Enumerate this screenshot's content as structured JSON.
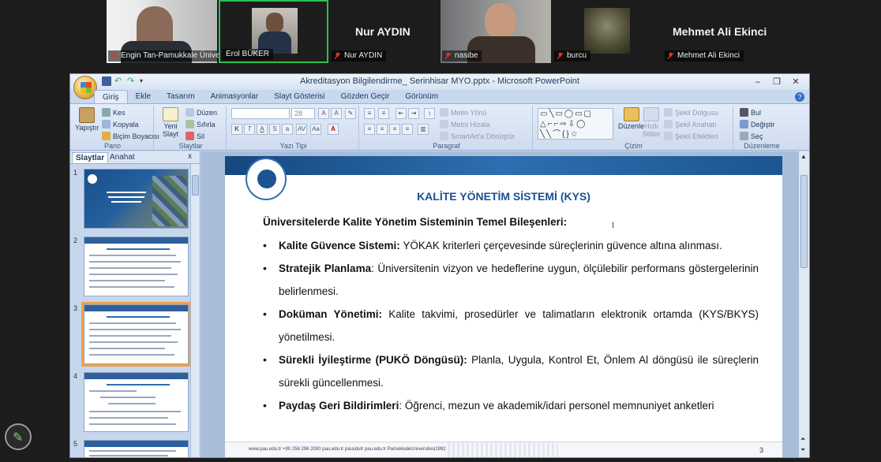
{
  "participants": [
    {
      "name": "Engin Tan-Pamukkale Üniver..."
    },
    {
      "name": "Erol BÜKER"
    },
    {
      "name": "Nur AYDIN",
      "big_name": "Nur AYDIN"
    },
    {
      "name": "nasibe"
    },
    {
      "name": "burcu"
    },
    {
      "name": "Mehmet Ali Ekinci",
      "big_name": "Mehmet Ali Ekinci"
    }
  ],
  "window": {
    "title": "Akreditasyon Bilgilendirme_ Serinhisar MYO.pptx - Microsoft PowerPoint",
    "controls": [
      "–",
      "❐",
      "✕"
    ]
  },
  "ribbon": {
    "tabs": [
      "Giriş",
      "Ekle",
      "Tasarım",
      "Animasyonlar",
      "Slayt Gösterisi",
      "Gözden Geçir",
      "Görünüm"
    ],
    "active_tab": "Giriş",
    "groups": {
      "pano": {
        "label": "Pano",
        "paste": "Yapıştır",
        "cut": "Kes",
        "copy": "Kopyala",
        "format_painter": "Biçim Boyacısı"
      },
      "slaytlar": {
        "label": "Slaytlar",
        "new_slide": "Yeni Slayt",
        "layout": "Düzen",
        "reset": "Sıfırla",
        "delete": "Sil"
      },
      "yazi_tipi": {
        "label": "Yazı Tipi",
        "font_size": "28"
      },
      "paragraf": {
        "label": "Paragraf",
        "text_direction": "Metin Yönü",
        "align_text": "Metni Hizala",
        "smartart": "SmartArt'a Dönüştür"
      },
      "cizim": {
        "label": "Çizim",
        "arrange": "Düzenle",
        "quick_styles": "Hızlı Stiller",
        "shape_fill": "Şekil Dolgusu",
        "shape_outline": "Şekil Anahatı",
        "shape_effects": "Şekil Efektleri"
      },
      "duzenleme": {
        "label": "Düzenleme",
        "find": "Bul",
        "replace": "Değiştir",
        "select": "Seç"
      }
    }
  },
  "pane": {
    "tabs": [
      "Slaytlar",
      "Anahat"
    ],
    "active_tab": "Slaytlar",
    "close": "x",
    "thumbnails": [
      {
        "number": "1"
      },
      {
        "number": "2"
      },
      {
        "number": "3",
        "selected": true
      },
      {
        "number": "4"
      },
      {
        "number": "5"
      }
    ]
  },
  "slide": {
    "title": "KALİTE YÖNETİM SİSTEMİ (KYS)",
    "subtitle": "Üniversitelerde Kalite Yönetim Sisteminin Temel Bileşenleri:",
    "bullets": [
      {
        "bold": "Kalite Güvence Sistemi:",
        "text": " YÖKAK kriterleri çerçevesinde süreçlerinin güvence altına alınması."
      },
      {
        "bold": "Stratejik Planlama",
        "text": ": Üniversitenin vizyon ve hedeflerine uygun, ölçülebilir performans göstergelerinin belirlenmesi."
      },
      {
        "bold": "Doküman Yönetimi:",
        "text": " Kalite takvimi, prosedürler ve talimatların elektronik ortamda (KYS/BKYS) yönetilmesi."
      },
      {
        "bold": "Sürekli İyileştirme (PUKÖ Döngüsü):",
        "text": " Planla, Uygula, Kontrol Et, Önlem Al döngüsü ile süreçlerin sürekli güncellenmesi."
      },
      {
        "bold": "Paydaş Geri Bildirimleri",
        "text": ": Öğrenci, mezun ve akademik/idari personel memnuniyet anketleri"
      }
    ],
    "footer_text": "www.pau.edu.tr   +90 258 296 2000   pau.edu.tr   pausdutr   pau.edu.tr   PamukkaleUniversitesi1992",
    "page_number": "3"
  },
  "colors": {
    "slide_title": "#1d4f8f",
    "slide_band": "#2d6fb0",
    "active_speaker_border": "#2fbf4f",
    "mic_muted": "#e0332f"
  }
}
